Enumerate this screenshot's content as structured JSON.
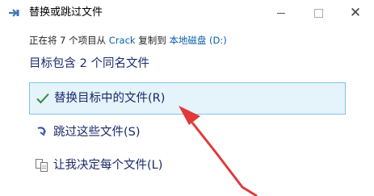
{
  "window": {
    "title": "替换或跳过文件",
    "icon": "file-move-icon"
  },
  "path_line": {
    "prefix": "正在将 7 个项目从 ",
    "source": "Crack",
    "middle": " 复制到 ",
    "destination": "本地磁盘 (D:)"
  },
  "subtitle": "目标包含 2 个同名文件",
  "options": [
    {
      "label": "替换目标中的文件(R)",
      "icon": "check-icon",
      "selected": true
    },
    {
      "label": "跳过这些文件(S)",
      "icon": "skip-arrow-icon",
      "selected": false
    },
    {
      "label": "让我决定每个文件(L)",
      "icon": "compare-files-icon",
      "selected": false
    }
  ],
  "colors": {
    "annotation_arrow": "#e03a3a",
    "selection_fill": "#e5f3fb",
    "selection_border": "#82c3e8",
    "link": "#0b5ea8",
    "option_text": "#1a2868"
  }
}
